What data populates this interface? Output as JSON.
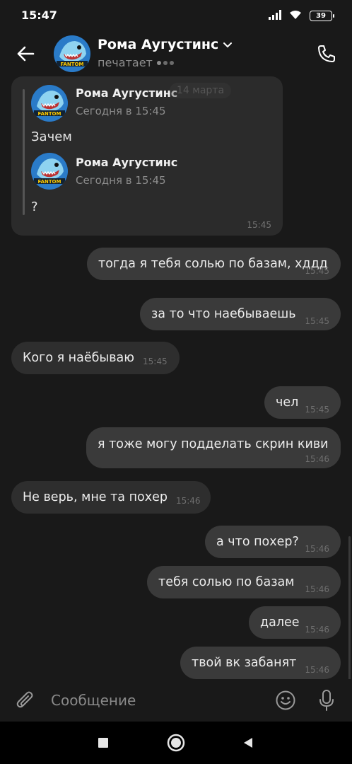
{
  "status_bar": {
    "time": "15:47",
    "battery": "39"
  },
  "header": {
    "contact_name": "Рома Аугустинс",
    "status": "печатает"
  },
  "date_pill": "14 марта",
  "forwarded": {
    "messages": [
      {
        "author": "Рома Аугустинс",
        "date": "Сегодня в 15:45",
        "text": "Зачем"
      },
      {
        "author": "Рома Аугустинс",
        "date": "Сегодня в 15:45",
        "text": "?"
      }
    ],
    "time": "15:45"
  },
  "messages": [
    {
      "dir": "out",
      "text": "тогда я тебя солью по базам, хддд",
      "time": "15:45"
    },
    {
      "dir": "out",
      "text": "за то что наебываешь",
      "time": "15:45"
    },
    {
      "dir": "in",
      "text": "Кого я наёбываю",
      "time": "15:45"
    },
    {
      "dir": "out",
      "text": "чел",
      "time": "15:45"
    },
    {
      "dir": "out",
      "text": "я тоже могу подделать скрин киви",
      "time": "15:46"
    },
    {
      "dir": "in",
      "text": "Не верь, мне та похер",
      "time": "15:46"
    },
    {
      "dir": "out",
      "text": "а что похер?",
      "time": "15:46"
    },
    {
      "dir": "out",
      "text": "тебя солью по базам",
      "time": "15:46"
    },
    {
      "dir": "out",
      "text": "далее",
      "time": "15:46"
    },
    {
      "dir": "out",
      "text": "твой вк забанят",
      "time": "15:46"
    }
  ],
  "composer": {
    "placeholder": "Сообщение"
  },
  "avatar_text": "FANTOM",
  "colors": {
    "background": "#191919",
    "bubble_out": "#3a3a3a",
    "bubble_in": "#2e2e2e",
    "avatar_bg": "#1e5fa8"
  }
}
